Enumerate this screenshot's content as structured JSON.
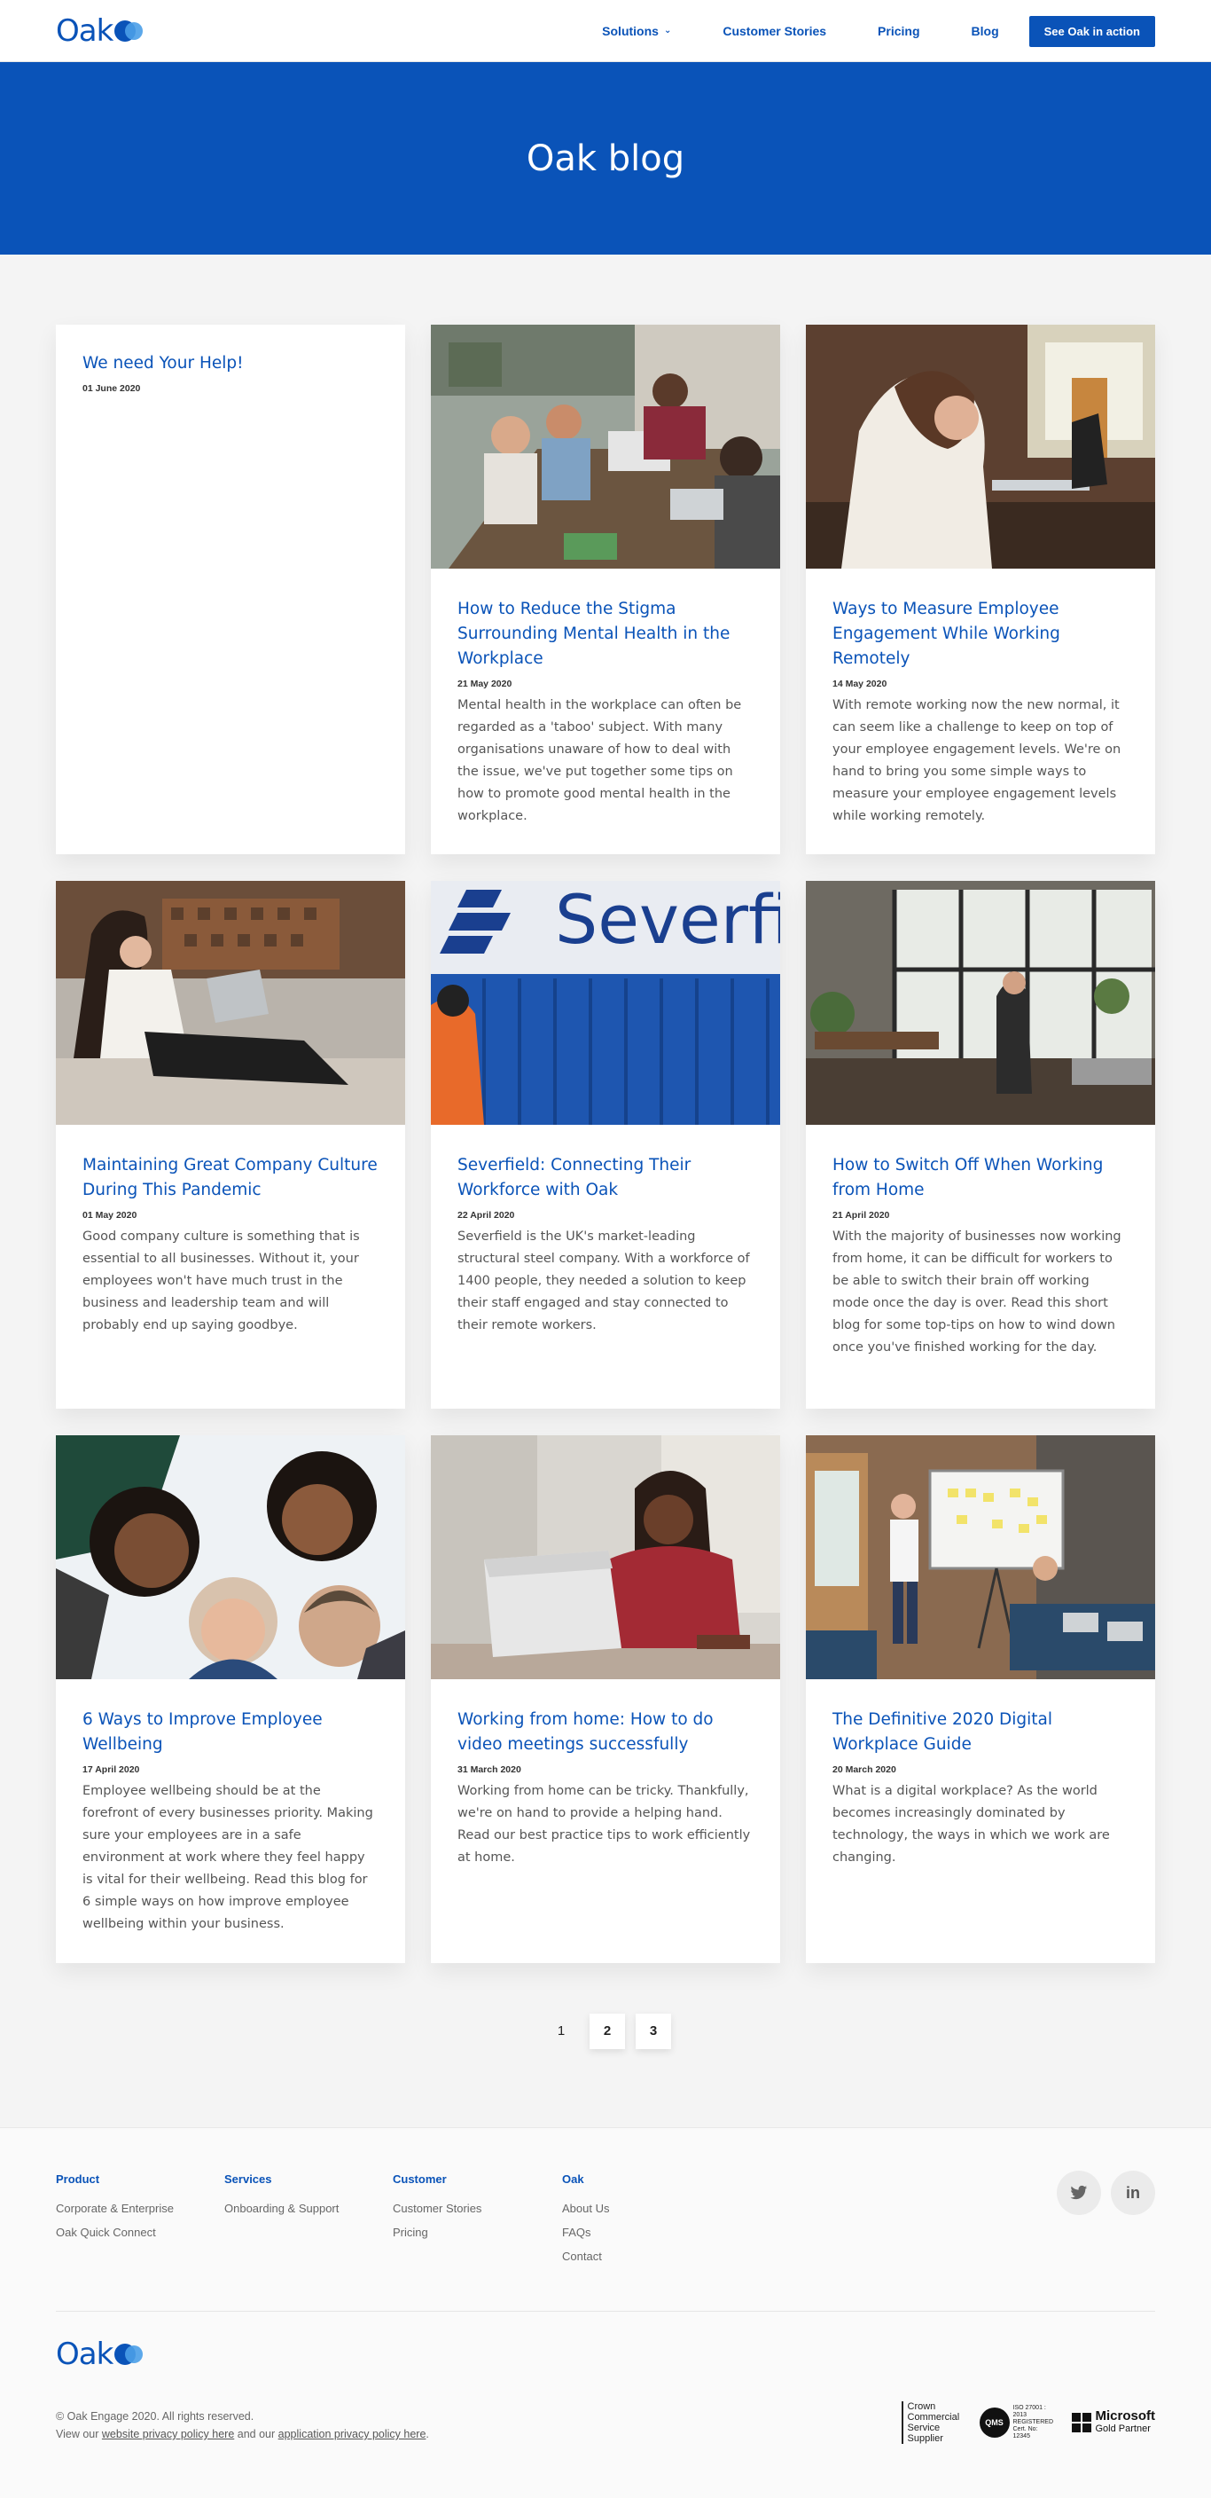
{
  "header": {
    "logo_text": "Oak",
    "nav": {
      "solutions": "Solutions",
      "customer_stories": "Customer Stories",
      "pricing": "Pricing",
      "blog": "Blog"
    },
    "cta": "See Oak in action"
  },
  "hero": {
    "title": "Oak blog"
  },
  "posts": [
    {
      "title": "We need Your Help!",
      "date": "01 June 2020",
      "excerpt": ""
    },
    {
      "title": "How to Reduce the Stigma Surrounding Mental Health in the Workplace",
      "date": "21 May 2020",
      "excerpt": "Mental health in the workplace can often be regarded as a 'taboo' subject. With many organisations unaware of how to deal with the issue, we've put together some tips on how to promote good mental health in the workplace."
    },
    {
      "title": "Ways to Measure Employee Engagement While Working Remotely",
      "date": "14 May 2020",
      "excerpt": "With remote working now the new normal, it can seem like a challenge to keep on top of your employee engagement levels. We're on hand to bring you some simple ways to measure your employee engagement levels while working remotely."
    },
    {
      "title": "Maintaining Great Company Culture During This Pandemic",
      "date": "01 May 2020",
      "excerpt": "Good company culture is something that is essential to all businesses. Without it, your employees won't have much trust in the business and leadership team and will probably end up saying goodbye."
    },
    {
      "title": "Severfield: Connecting Their Workforce with Oak",
      "date": "22 April 2020",
      "excerpt": "Severfield is the UK's market-leading structural steel company. With a workforce of 1400 people, they needed a solution to keep their staff engaged and stay connected to their remote workers."
    },
    {
      "title": "How to Switch Off When Working from Home",
      "date": "21 April 2020",
      "excerpt": "With the majority of businesses now working from home, it can be difficult for workers to be able to switch their brain off working mode once the day is over. Read this short blog for some top-tips on how to wind down once you've finished working for the day."
    },
    {
      "title": "6 Ways to Improve Employee Wellbeing",
      "date": "17 April 2020",
      "excerpt": "Employee wellbeing should be at the forefront of every businesses priority. Making sure your employees are in a safe environment at work where they feel happy is vital for their wellbeing. Read this blog for 6 simple ways on how improve employee wellbeing within your business."
    },
    {
      "title": "Working from home: How to do video meetings successfully",
      "date": "31 March 2020",
      "excerpt": "Working from home can be tricky. Thankfully, we're on hand to provide a helping hand. Read our best practice tips to work efficiently at home."
    },
    {
      "title": "The Definitive 2020 Digital Workplace Guide",
      "date": "20 March 2020",
      "excerpt": "What is a digital workplace? As the world becomes increasingly dominated by technology, the ways in which we work are changing."
    }
  ],
  "severfield_sign": "Severfie",
  "pagination": [
    "1",
    "2",
    "3"
  ],
  "footer": {
    "product": {
      "heading": "Product",
      "links": [
        "Corporate & Enterprise",
        "Oak Quick Connect"
      ]
    },
    "services": {
      "heading": "Services",
      "links": [
        "Onboarding & Support"
      ]
    },
    "customer": {
      "heading": "Customer",
      "links": [
        "Customer Stories",
        "Pricing"
      ]
    },
    "oak": {
      "heading": "Oak",
      "links": [
        "About Us",
        "FAQs",
        "Contact"
      ]
    },
    "social": {
      "twitter": "twitter-icon",
      "linkedin": "linkedin-icon",
      "linkedin_text": "in"
    },
    "logo_text": "Oak",
    "copyright": "© Oak Engage 2020. All rights reserved.",
    "privacy_prefix": "View our",
    "website_privacy": "website privacy policy here",
    "privacy_middle": "and our",
    "app_privacy": "application privacy policy here",
    "privacy_suffix": ".",
    "badges": {
      "ccs": "Crown Commercial Service Supplier",
      "iso_mark": "QMS",
      "iso_text": "ISO 27001 : 2013 REGISTERED Cert. No: 12345",
      "ms_name": "Microsoft",
      "ms_sub": "Gold Partner"
    }
  },
  "colors": {
    "brand": "#0a53b8",
    "background": "#f4f4f4"
  }
}
